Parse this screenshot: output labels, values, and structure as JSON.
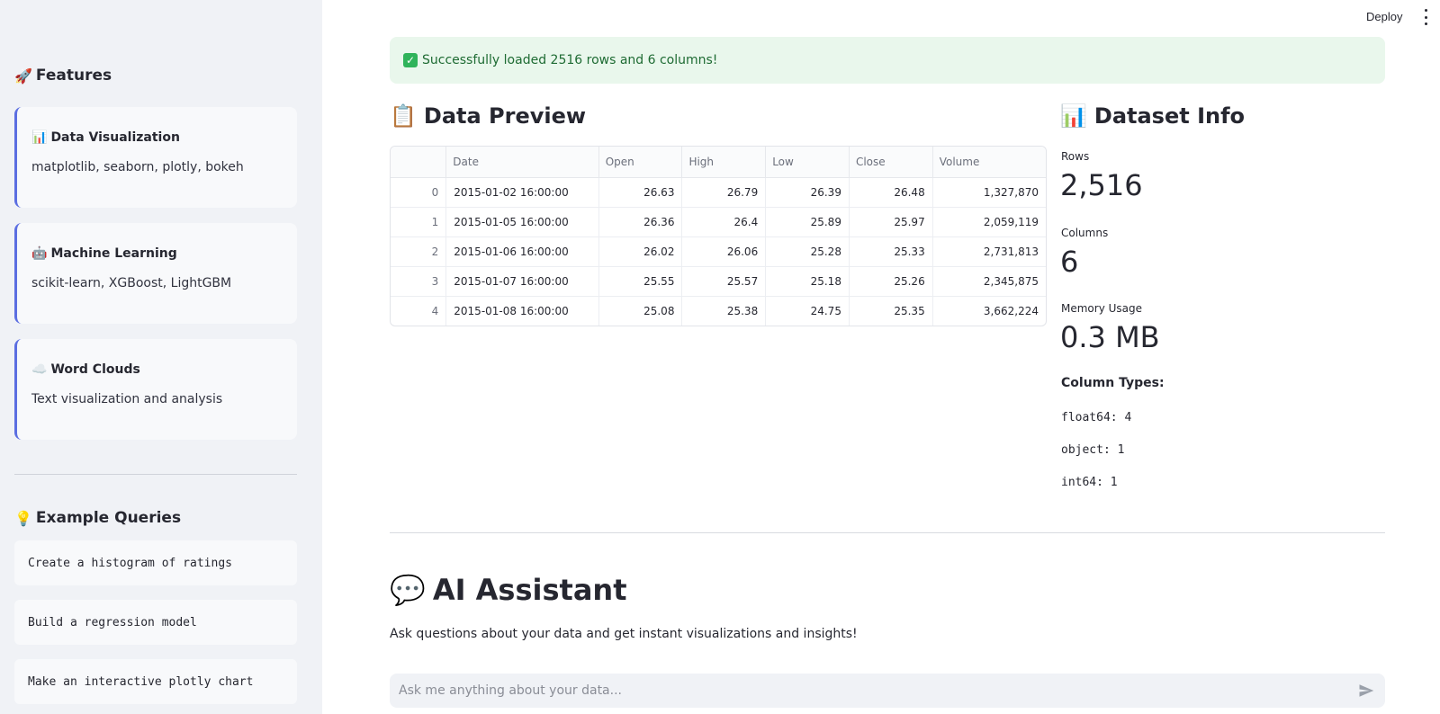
{
  "sidebar": {
    "features_heading": "Features",
    "features_emoji": "🚀",
    "features": [
      {
        "emoji": "📊",
        "title": "Data Visualization",
        "desc": "matplotlib, seaborn, plotly, bokeh"
      },
      {
        "emoji": "🤖",
        "title": "Machine Learning",
        "desc": "scikit-learn, XGBoost, LightGBM"
      },
      {
        "emoji": "☁️",
        "title": "Word Clouds",
        "desc": "Text visualization and analysis"
      }
    ],
    "queries_heading": "Example Queries",
    "queries_emoji": "💡",
    "queries": [
      "Create a histogram of ratings",
      "Build a regression model",
      "Make an interactive plotly chart"
    ]
  },
  "header": {
    "deploy_label": "Deploy"
  },
  "main": {
    "success_message": "Successfully loaded 2516 rows and 6 columns!",
    "preview_title": "Data Preview",
    "preview_emoji": "📋",
    "table": {
      "columns": [
        "",
        "Date",
        "Open",
        "High",
        "Low",
        "Close",
        "Volume"
      ],
      "rows": [
        [
          "0",
          "2015-01-02 16:00:00",
          "26.63",
          "26.79",
          "26.39",
          "26.48",
          "1,327,870"
        ],
        [
          "1",
          "2015-01-05 16:00:00",
          "26.36",
          "26.4",
          "25.89",
          "25.97",
          "2,059,119"
        ],
        [
          "2",
          "2015-01-06 16:00:00",
          "26.02",
          "26.06",
          "25.28",
          "25.33",
          "2,731,813"
        ],
        [
          "3",
          "2015-01-07 16:00:00",
          "25.55",
          "25.57",
          "25.18",
          "25.26",
          "2,345,875"
        ],
        [
          "4",
          "2015-01-08 16:00:00",
          "25.08",
          "25.38",
          "24.75",
          "25.35",
          "3,662,224"
        ]
      ]
    },
    "info_title": "Dataset Info",
    "info_emoji": "📊",
    "metrics": [
      {
        "label": "Rows",
        "value": "2,516"
      },
      {
        "label": "Columns",
        "value": "6"
      },
      {
        "label": "Memory Usage",
        "value": "0.3 MB"
      }
    ],
    "column_types_title": "Column Types:",
    "column_types": [
      "float64: 4",
      "object: 1",
      "int64: 1"
    ],
    "assistant_title": "AI Assistant",
    "assistant_emoji": "💬",
    "assistant_desc": "Ask questions about your data and get instant visualizations and insights!",
    "chat_placeholder": "Ask me anything about your data...",
    "accent_color": "#5b6ee1"
  }
}
